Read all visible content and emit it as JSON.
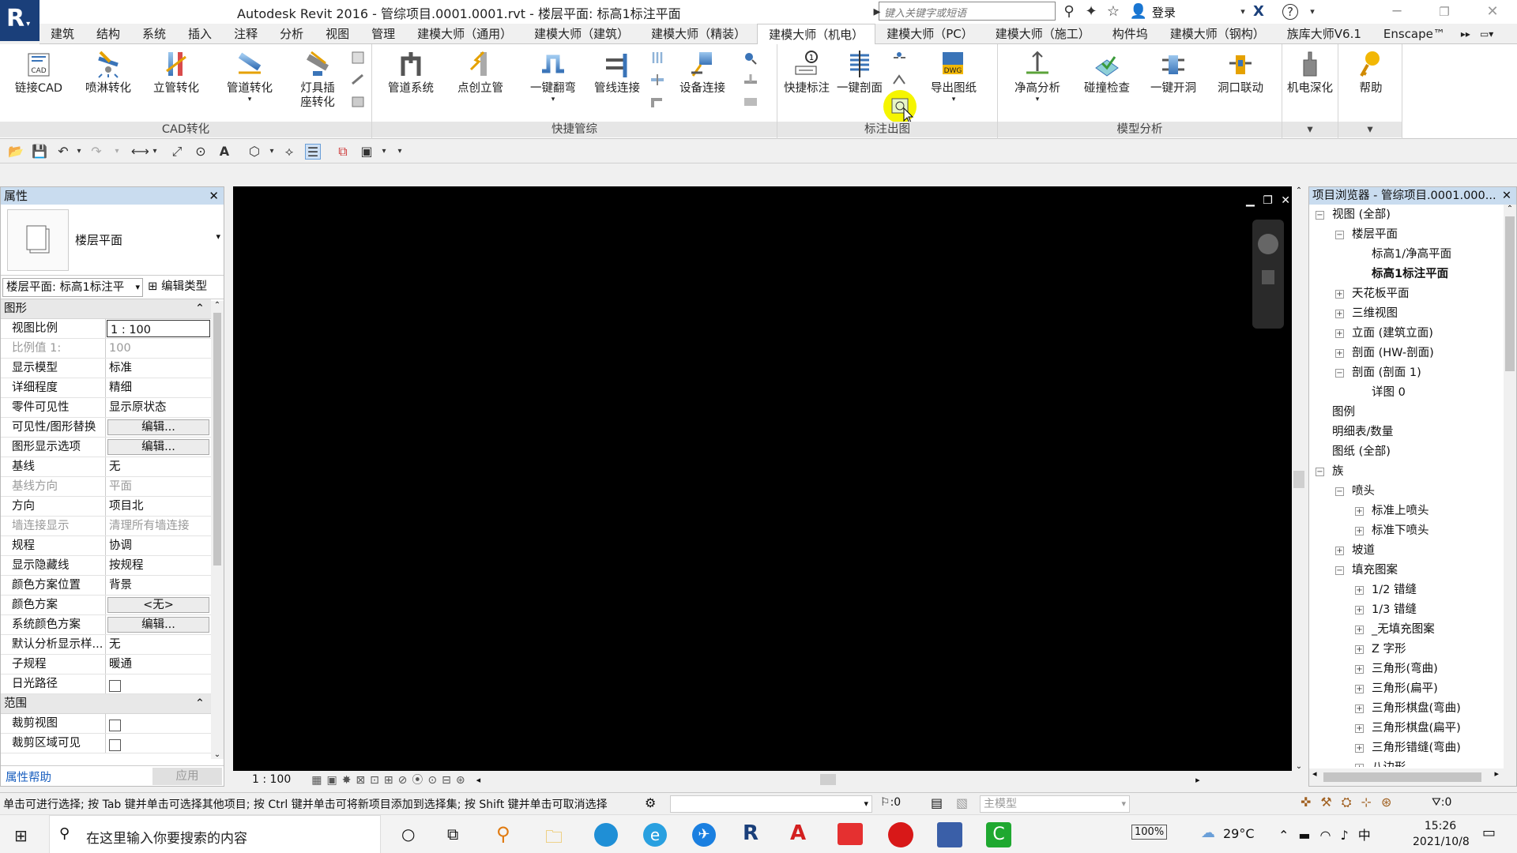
{
  "app": {
    "logo": "R",
    "title": "Autodesk Revit 2016 -     管综项目.0001.0001.rvt - 楼层平面: 标高1标注平面",
    "search_placeholder": "键入关键字或短语",
    "login_label": "登录"
  },
  "tabs": [
    "建筑",
    "结构",
    "系统",
    "插入",
    "注释",
    "分析",
    "视图",
    "管理",
    "建模大师（通用）",
    "建模大师（建筑）",
    "建模大师（精装）",
    "建模大师（机电）",
    "建模大师（PC）",
    "建模大师（施工）",
    "构件坞",
    "建模大师（钢构）",
    "族库大师V6.1",
    "Enscape™"
  ],
  "active_tab": "建模大师（机电）",
  "ribbon": {
    "buttons": [
      "链接CAD",
      "喷淋转化",
      "立管转化",
      "管道转化",
      "灯具插\n座转化",
      "管道系统",
      "点创立管",
      "一键翻弯",
      "管线连接",
      "设备连接",
      "快捷标注",
      "一键剖面",
      "导出图纸",
      "净高分析",
      "碰撞检查",
      "一键开洞",
      "洞口联动",
      "机电深化",
      "帮助"
    ],
    "panels": [
      "CAD转化",
      "快捷管综",
      "标注出图",
      "模型分析"
    ]
  },
  "properties": {
    "title": "属性",
    "type_name": "楼层平面",
    "instance_selector": "楼层平面: 标高1标注平",
    "edit_type": "编辑类型",
    "group_graphics": "图形",
    "group_range": "范围",
    "rows": [
      {
        "k": "视图比例",
        "v": "1 : 100"
      },
      {
        "k": "比例值 1:",
        "v": "100"
      },
      {
        "k": "显示模型",
        "v": "标准"
      },
      {
        "k": "详细程度",
        "v": "精细"
      },
      {
        "k": "零件可见性",
        "v": "显示原状态"
      },
      {
        "k": "可见性/图形替换",
        "v": "编辑..."
      },
      {
        "k": "图形显示选项",
        "v": "编辑..."
      },
      {
        "k": "基线",
        "v": "无"
      },
      {
        "k": "基线方向",
        "v": "平面"
      },
      {
        "k": "方向",
        "v": "项目北"
      },
      {
        "k": "墙连接显示",
        "v": "清理所有墙连接"
      },
      {
        "k": "规程",
        "v": "协调"
      },
      {
        "k": "显示隐藏线",
        "v": "按规程"
      },
      {
        "k": "颜色方案位置",
        "v": "背景"
      },
      {
        "k": "颜色方案",
        "v": "<无>"
      },
      {
        "k": "系统颜色方案",
        "v": "编辑..."
      },
      {
        "k": "默认分析显示样...",
        "v": "无"
      },
      {
        "k": "子规程",
        "v": "暖通"
      },
      {
        "k": "日光路径",
        "v": ""
      },
      {
        "k": "裁剪视图",
        "v": ""
      },
      {
        "k": "裁剪区域可见",
        "v": ""
      }
    ],
    "help_link": "属性帮助",
    "apply_button": "应用"
  },
  "view_bar": {
    "scale": "1 : 100"
  },
  "browser": {
    "title": "项目浏览器 - 管综项目.0001.000...",
    "nodes": [
      {
        "t": "视图 (全部)",
        "lvl": 0,
        "bx": "−"
      },
      {
        "t": "楼层平面",
        "lvl": 1,
        "bx": "−"
      },
      {
        "t": "标高1/净高平面",
        "lvl": 2,
        "bx": ""
      },
      {
        "t": "标高1标注平面",
        "lvl": 2,
        "bx": "",
        "bold": true
      },
      {
        "t": "天花板平面",
        "lvl": 1,
        "bx": "+"
      },
      {
        "t": "三维视图",
        "lvl": 1,
        "bx": "+"
      },
      {
        "t": "立面 (建筑立面)",
        "lvl": 1,
        "bx": "+"
      },
      {
        "t": "剖面 (HW-剖面)",
        "lvl": 1,
        "bx": "+"
      },
      {
        "t": "剖面 (剖面 1)",
        "lvl": 1,
        "bx": "−"
      },
      {
        "t": "详图 0",
        "lvl": 2,
        "bx": ""
      },
      {
        "t": "图例",
        "lvl": 0,
        "bx": ""
      },
      {
        "t": "明细表/数量",
        "lvl": 0,
        "bx": ""
      },
      {
        "t": "图纸 (全部)",
        "lvl": 0,
        "bx": ""
      },
      {
        "t": "族",
        "lvl": 0,
        "bx": "−"
      },
      {
        "t": "喷头",
        "lvl": 1,
        "bx": "−"
      },
      {
        "t": "标准上喷头",
        "lvl": 2,
        "bx": "+"
      },
      {
        "t": "标准下喷头",
        "lvl": 2,
        "bx": "+"
      },
      {
        "t": "坡道",
        "lvl": 1,
        "bx": "+"
      },
      {
        "t": "填充图案",
        "lvl": 1,
        "bx": "−"
      },
      {
        "t": "1/2 错缝",
        "lvl": 2,
        "bx": "+"
      },
      {
        "t": "1/3 错缝",
        "lvl": 2,
        "bx": "+"
      },
      {
        "t": "_无填充图案",
        "lvl": 2,
        "bx": "+"
      },
      {
        "t": "Z 字形",
        "lvl": 2,
        "bx": "+"
      },
      {
        "t": "三角形(弯曲)",
        "lvl": 2,
        "bx": "+"
      },
      {
        "t": "三角形(扁平)",
        "lvl": 2,
        "bx": "+"
      },
      {
        "t": "三角形棋盘(弯曲)",
        "lvl": 2,
        "bx": "+"
      },
      {
        "t": "三角形棋盘(扁平)",
        "lvl": 2,
        "bx": "+"
      },
      {
        "t": "三角形错缝(弯曲)",
        "lvl": 2,
        "bx": "+"
      },
      {
        "t": "八边形",
        "lvl": 2,
        "bx": "+"
      }
    ]
  },
  "status": {
    "hint": "单击可进行选择; 按 Tab 键并单击可选择其他项目; 按 Ctrl 键并单击可将新项目添加到选择集; 按 Shift 键并单击可取消选择",
    "count": ":0",
    "model": "主模型",
    "filter_count": ":0"
  },
  "taskbar": {
    "search_placeholder": "在这里输入你要搜索的内容",
    "battery": "100%",
    "temperature": "29°C",
    "time": "15:26",
    "date": "2021/10/8"
  },
  "colors": {
    "accent": "#1a3f7a",
    "highlight": "#f5f500",
    "canvas": "#000000",
    "panel_head": "#c9dcef"
  }
}
